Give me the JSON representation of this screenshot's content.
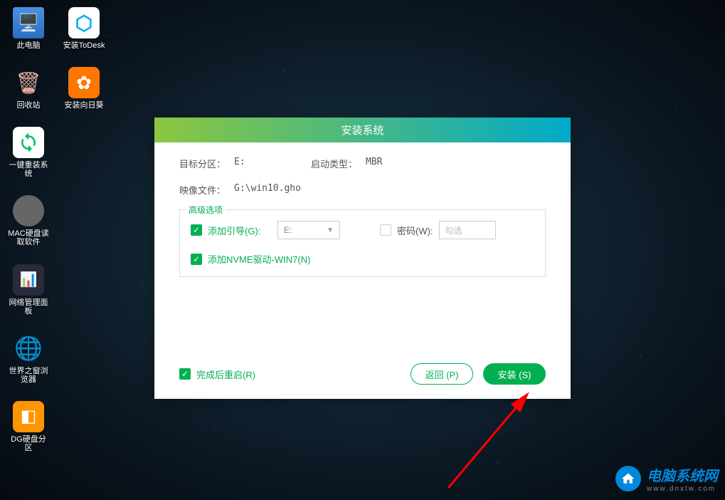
{
  "desktop": {
    "col1": [
      {
        "label": "此电脑",
        "icon": "this-pc"
      },
      {
        "label": "回收站",
        "icon": "recycle"
      },
      {
        "label": "一键重装系统",
        "icon": "reinstall"
      },
      {
        "label": "MAC硬盘读取软件",
        "icon": "mac"
      },
      {
        "label": "网络管理面板",
        "icon": "network"
      },
      {
        "label": "世界之窗浏览器",
        "icon": "browser"
      },
      {
        "label": "DG硬盘分区",
        "icon": "dg"
      }
    ],
    "col2": [
      {
        "label": "安装ToDesk",
        "icon": "todesk"
      },
      {
        "label": "安装向日葵",
        "icon": "sunflower"
      }
    ]
  },
  "dialog": {
    "title": "安装系统",
    "target_partition_label": "目标分区：",
    "target_partition_value": "E:",
    "boot_type_label": "启动类型：",
    "boot_type_value": "MBR",
    "image_file_label": "映像文件：",
    "image_file_value": "G:\\win10.gho",
    "advanced_legend": "高级选项",
    "add_boot_label": "添加引导(G):",
    "add_boot_dropdown": "E:",
    "password_label": "密码(W):",
    "password_placeholder": "勾选",
    "nvme_label": "添加NVME驱动-WIN7(N)",
    "restart_label": "完成后重启(R)",
    "back_button": "返回 (P)",
    "install_button": "安装 (S)"
  },
  "watermark": {
    "title": "电脑系统网",
    "url": "www.dnxtw.com"
  }
}
